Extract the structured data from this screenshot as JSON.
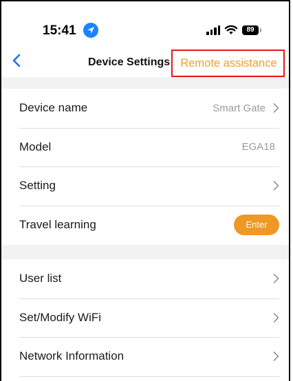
{
  "status_bar": {
    "time": "15:41",
    "battery": "89"
  },
  "nav": {
    "title": "Device Settings",
    "remote_assistance": "Remote assistance"
  },
  "section1": [
    {
      "label": "Device name",
      "value": "Smart Gate",
      "chevron": true
    },
    {
      "label": "Model",
      "value": "EGA18",
      "chevron": false
    },
    {
      "label": "Setting",
      "value": "",
      "chevron": true
    },
    {
      "label": "Travel learning",
      "button": "Enter"
    }
  ],
  "section2": [
    {
      "label": "User list"
    },
    {
      "label": "Set/Modify WiFi"
    },
    {
      "label": "Network Information"
    }
  ],
  "colors": {
    "accent": "#ee9826",
    "highlight_box": "#e8141d",
    "back_arrow": "#1a73e8"
  }
}
